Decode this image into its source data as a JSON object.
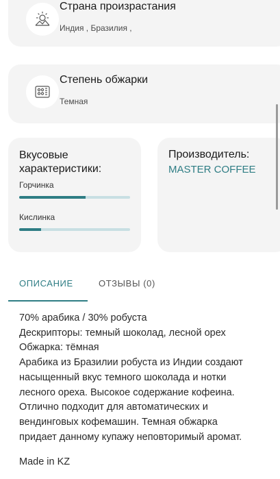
{
  "origin": {
    "title": "Страна произрастания",
    "value": "Индия , Бразилия ,",
    "icon": "sun-mountain-icon"
  },
  "roast": {
    "title": "Степень обжарки",
    "value": "Темная",
    "icon": "roaster-icon"
  },
  "taste": {
    "title": "Вкусовые характеристики:",
    "bars": [
      {
        "label": "Горчинка",
        "fraction": 0.6
      },
      {
        "label": "Кислинка",
        "fraction": 0.2
      }
    ]
  },
  "maker": {
    "title": "Производитель:",
    "name": "MASTER COFFEE"
  },
  "tabs": {
    "description": "ОПИСАНИЕ",
    "reviews": "ОТЗЫВЫ (0)"
  },
  "description": {
    "lines": [
      "70% арабика / 30% робуста",
      "Дескрипторы: темный шоколад, лесной орех",
      "Обжарка: тёмная",
      "Арабика из Бразилии робуста из Индии создают",
      "насыщенный вкус темного шоколада и нотки",
      "лесного ореха. Высокое содержание кофеина.",
      "Отлично подходит для автоматических и",
      "вендинговых кофемашин. Темная обжарка",
      "придает данному купажу неповторимый аромат."
    ],
    "made_in": "Made in KZ"
  },
  "colors": {
    "accent": "#2e7d84",
    "card_bg": "#f4f4f4",
    "bar_track": "#c8dfe3"
  }
}
